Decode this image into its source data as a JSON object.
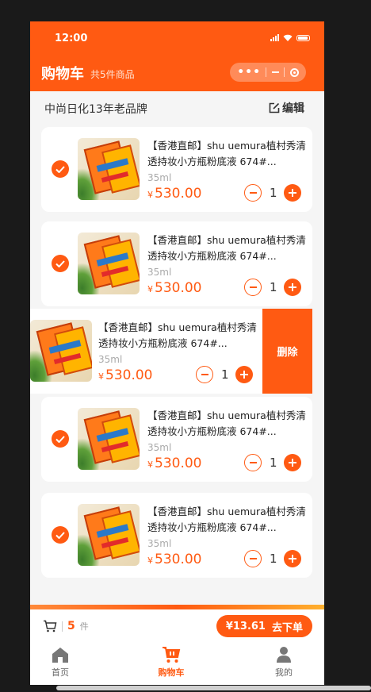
{
  "status_bar": {
    "time": "12:00"
  },
  "header": {
    "title": "购物车",
    "item_count": "共5件商品"
  },
  "store": {
    "name": "中尚日化13年老品牌",
    "edit_label": "编辑"
  },
  "cart_items": [
    {
      "title": "【香港直邮】shu uemura植村秀清透持妆小方瓶粉底液 674#...",
      "spec": "35ml",
      "currency": "¥",
      "price": "530.00",
      "quantity": "1",
      "selected": true
    },
    {
      "title": "【香港直邮】shu uemura植村秀清透持妆小方瓶粉底液 674#...",
      "spec": "35ml",
      "currency": "¥",
      "price": "530.00",
      "quantity": "1",
      "selected": true
    },
    {
      "title": "【香港直邮】shu uemura植村秀清透持妆小方瓶粉底液 674#...",
      "spec": "35ml",
      "currency": "¥",
      "price": "530.00",
      "quantity": "1",
      "selected": true,
      "swiped": true,
      "delete_label": "删除"
    },
    {
      "title": "【香港直邮】shu uemura植村秀清透持妆小方瓶粉底液 674#...",
      "spec": "35ml",
      "currency": "¥",
      "price": "530.00",
      "quantity": "1",
      "selected": true
    },
    {
      "title": "【香港直邮】shu uemura植村秀清透持妆小方瓶粉底液 674#...",
      "spec": "35ml",
      "currency": "¥",
      "price": "530.00",
      "quantity": "1",
      "selected": true
    }
  ],
  "footer": {
    "cart_count": "5",
    "cart_unit": "件",
    "total": "¥13.61",
    "checkout_label": "去下单"
  },
  "tabbar": [
    {
      "label": "首页",
      "icon": "home-icon",
      "active": false
    },
    {
      "label": "购物车",
      "icon": "cart-icon",
      "active": true
    },
    {
      "label": "我的",
      "icon": "user-icon",
      "active": false
    }
  ],
  "colors": {
    "accent": "#ff5a12",
    "background": "#f5f5f5"
  }
}
